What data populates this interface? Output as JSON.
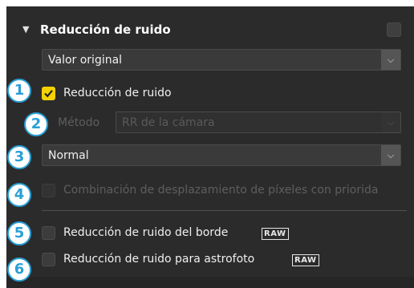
{
  "section": {
    "title": "Reducción de ruido",
    "collapse_icon": "triangle-down-icon"
  },
  "preset": {
    "value": "Valor original"
  },
  "noise_reduction": {
    "label": "Reducción de ruido",
    "checked": true
  },
  "method": {
    "label": "Método",
    "value": "RR de la cámara"
  },
  "strength": {
    "value": "Normal"
  },
  "pixel_shift": {
    "label": "Combinación de desplazamiento de píxeles con priorida",
    "checked": false
  },
  "edge_nr": {
    "label": "Reducción de ruido del borde",
    "badge": "RAW",
    "checked": false
  },
  "astro_nr": {
    "label": "Reducción de ruido para astrofoto",
    "badge": "RAW",
    "checked": false
  },
  "callouts": [
    "1",
    "2",
    "3",
    "4",
    "5",
    "6"
  ],
  "colors": {
    "accent_check": "#f5d100",
    "callout": "#2a9fd6",
    "panel": "#2b2b2b"
  }
}
